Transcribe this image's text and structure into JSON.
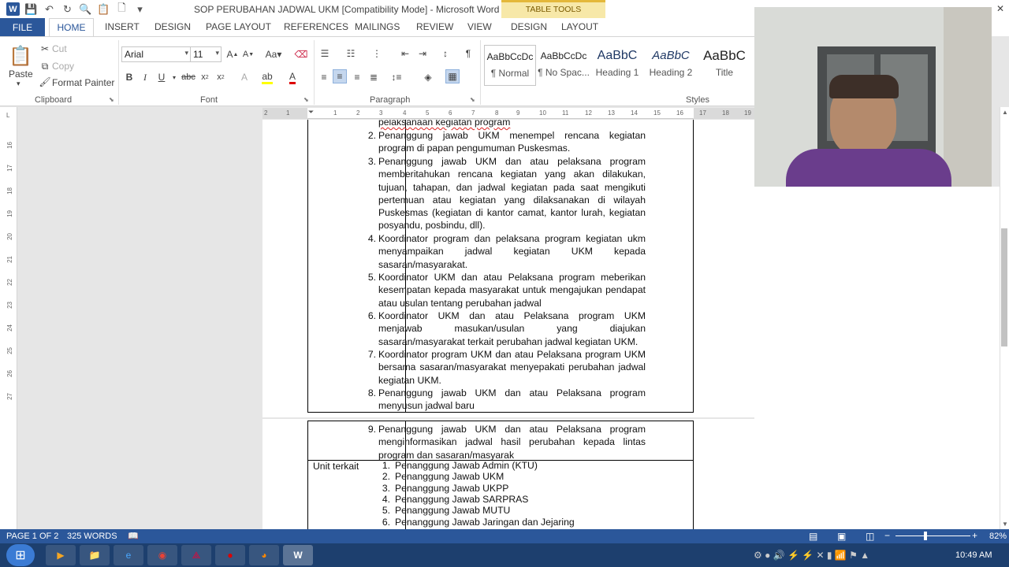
{
  "window": {
    "title": "SOP PERUBAHAN JADWAL UKM [Compatibility Mode] - Microsoft Word",
    "context_tab": "TABLE TOOLS"
  },
  "ribbon_tabs": [
    "FILE",
    "HOME",
    "INSERT",
    "DESIGN",
    "PAGE LAYOUT",
    "REFERENCES",
    "MAILINGS",
    "REVIEW",
    "VIEW",
    "DESIGN",
    "LAYOUT"
  ],
  "clipboard": {
    "paste": "Paste",
    "cut": "Cut",
    "copy": "Copy",
    "format_painter": "Format Painter",
    "label": "Clipboard"
  },
  "font": {
    "name": "Arial",
    "size": "11",
    "label": "Font"
  },
  "paragraph": {
    "label": "Paragraph"
  },
  "styles": {
    "label": "Styles",
    "items": [
      {
        "preview": "AaBbCcDc",
        "name": "¶ Normal"
      },
      {
        "preview": "AaBbCcDc",
        "name": "¶ No Spac..."
      },
      {
        "preview": "AaBbC",
        "name": "Heading 1"
      },
      {
        "preview": "AaBbC",
        "name": "Heading 2"
      },
      {
        "preview": "AaBbC",
        "name": "Title"
      }
    ]
  },
  "ruler": {
    "top": [
      "2",
      "1",
      "1",
      "2",
      "3",
      "4",
      "5",
      "6",
      "7",
      "8",
      "9",
      "10",
      "11",
      "12",
      "13",
      "14",
      "15",
      "16",
      "17",
      "18",
      "19"
    ],
    "left": [
      "16",
      "17",
      "18",
      "19",
      "20",
      "21",
      "22",
      "23",
      "24",
      "25",
      "26",
      "27"
    ]
  },
  "document": {
    "cut_top": "pelaksanaan kegiatan program",
    "items": [
      {
        "num": "2.",
        "text": "Penanggung jawab UKM menempel rencana kegiatan program di papan pengumuman Puskesmas."
      },
      {
        "num": "3.",
        "text": "Penanggung jawab UKM dan atau pelaksana program memberitahukan rencana kegiatan yang akan dilakukan, tujuan, tahapan, dan jadwal kegiatan pada saat mengikuti pertemuan atau kegiatan yang dilaksanakan di wilayah Puskesmas (kegiatan di kantor camat, kantor lurah, kegiatan posyandu, posbindu, dll)."
      },
      {
        "num": "4.",
        "text": "Koordinator program dan pelaksana program kegiatan ukm menyampaikan jadwal kegiatan UKM kepada sasaran/masyarakat."
      },
      {
        "num": "5.",
        "text": "Koordinator UKM dan atau Pelaksana program meberikan kesempatan kepada masyarakat untuk mengajukan pendapat atau usulan tentang perubahan jadwal"
      },
      {
        "num": "6.",
        "text": "Koordinator UKM dan atau Pelaksana program UKM menjawab masukan/usulan yang diajukan sasaran/masyarakat terkait perubahan jadwal kegiatan UKM."
      },
      {
        "num": "7.",
        "text": "Koordinator program UKM dan atau Pelaksana program UKM bersama sasaran/masyarakat menyepakati perubahan jadwal kegiatan UKM."
      },
      {
        "num": "8.",
        "text": "Penanggung jawab UKM dan atau Pelaksana program menyusun jadwal baru"
      }
    ],
    "page2": {
      "item9": {
        "num": "9.",
        "text": "Penanggung jawab UKM dan atau Pelaksana program menginformasikan jadwal hasil perubahan kepada lintas program dan sasaran/masyarak"
      },
      "unit_label": "Unit terkait",
      "units": [
        {
          "num": "1.",
          "text": "Penanggung Jawab Admin (KTU)"
        },
        {
          "num": "2.",
          "text": "Penanggung Jawab UKM"
        },
        {
          "num": "3.",
          "text": "Penanggung Jawab UKPP"
        },
        {
          "num": "4.",
          "text": "Penanggung Jawab SARPRAS"
        },
        {
          "num": "5.",
          "text": "Penanggung Jawab MUTU"
        },
        {
          "num": "6.",
          "text": "Penanggung Jawab Jaringan dan Jejaring"
        }
      ]
    }
  },
  "status": {
    "page": "PAGE 1 OF 2",
    "words": "325 WORDS",
    "zoom": "82%"
  },
  "clock": "10:49 AM",
  "colors": {
    "word_blue": "#2b579a",
    "taskbar": "#1d3f6e",
    "table_tools": "#f7e8a8"
  }
}
